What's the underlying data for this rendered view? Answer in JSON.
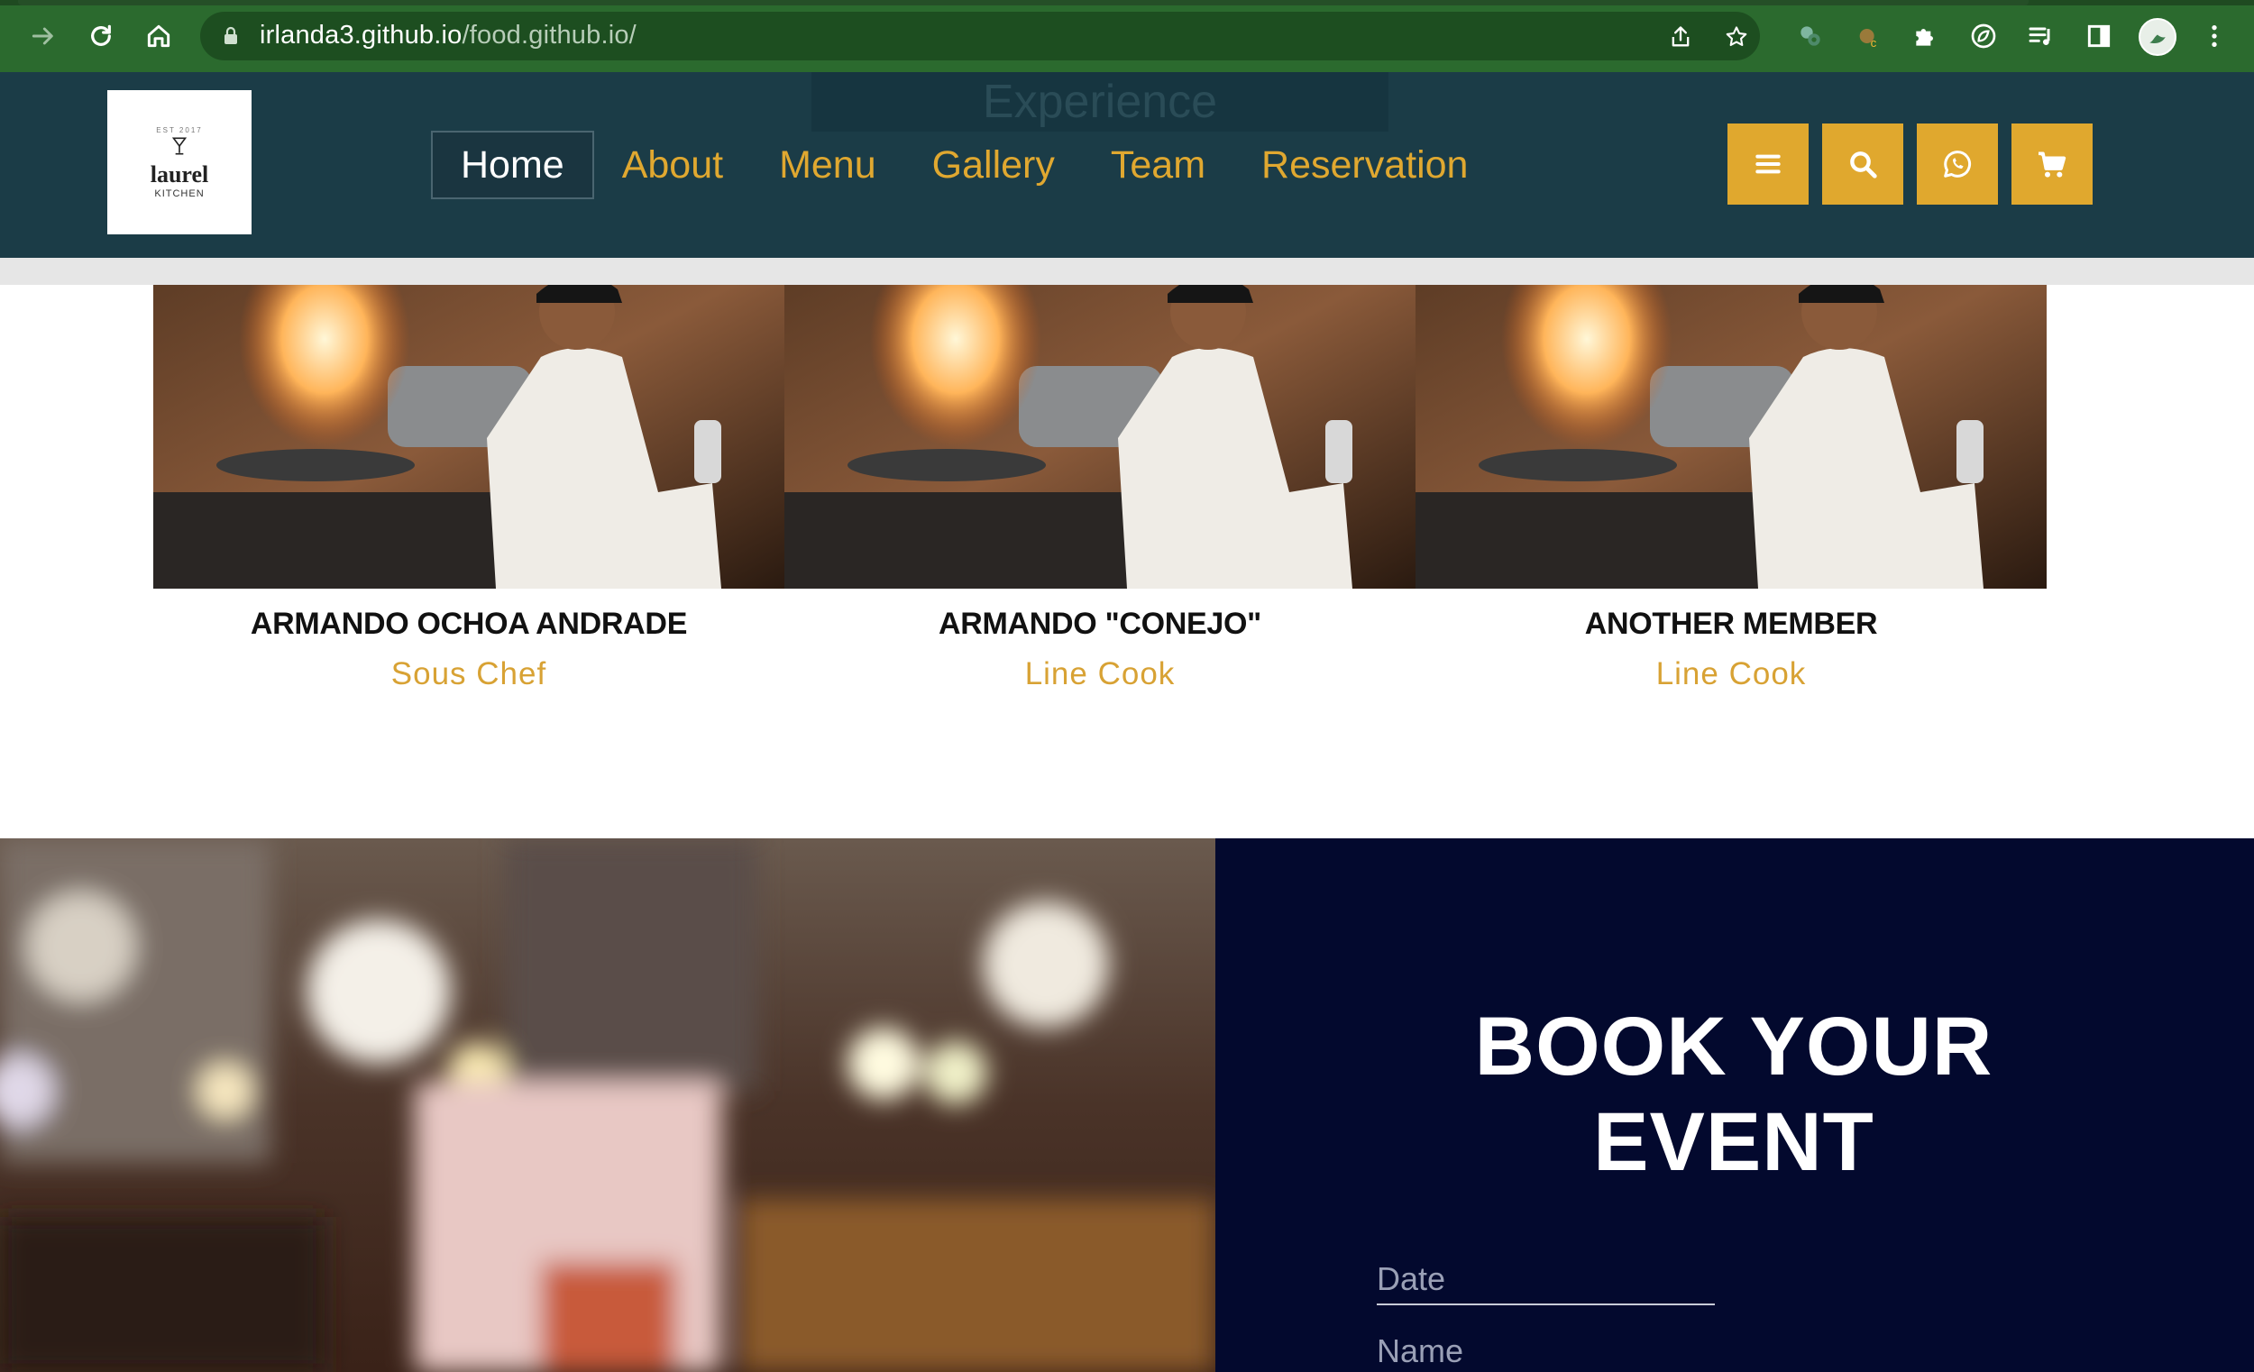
{
  "browser": {
    "url_host": "irlanda3.github.io",
    "url_path": "/food.github.io/"
  },
  "site": {
    "logo": {
      "word": "laurel",
      "sub": "KITCHEN",
      "est": "EST 2017"
    },
    "ghost_heading": "Experience",
    "nav": {
      "home": "Home",
      "about": "About",
      "menu": "Menu",
      "gallery": "Gallery",
      "team": "Team",
      "reservation": "Reservation"
    },
    "header_buttons": [
      "menu-icon",
      "search-icon",
      "whatsapp-icon",
      "cart-icon"
    ],
    "accent_color": "#e0a82e",
    "header_color": "#1b3c47"
  },
  "team": {
    "members": [
      {
        "name": "ARMANDO OCHOA ANDRADE",
        "role": "Sous Chef"
      },
      {
        "name": "ARMANDO \"CONEJO\"",
        "role": "Line Cook"
      },
      {
        "name": "ANOTHER MEMBER",
        "role": "Line Cook"
      }
    ]
  },
  "booking": {
    "title_line1": "BOOK YOUR",
    "title_line2": "EVENT",
    "date_placeholder": "Date",
    "name_placeholder": "Name",
    "panel_color": "#03092e"
  }
}
